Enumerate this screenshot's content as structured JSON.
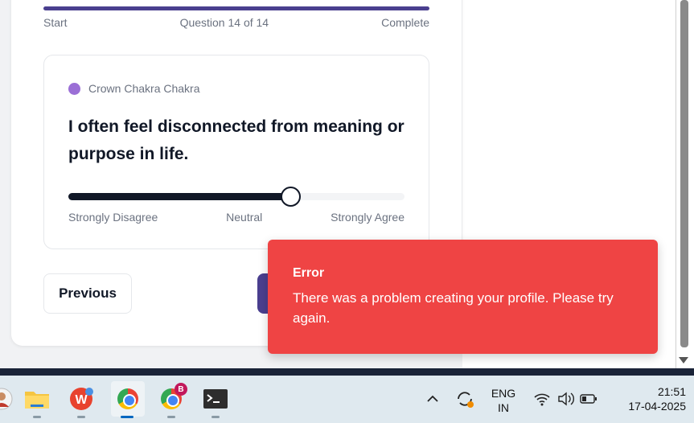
{
  "progress": {
    "start_label": "Start",
    "counter_label": "Question 14 of 14",
    "end_label": "Complete",
    "value_fraction": 1.0,
    "color": "#4a3f8f"
  },
  "question_card": {
    "category": "Crown Chakra Chakra",
    "category_color": "#9b6fd6",
    "question": "I often feel disconnected from meaning or purpose in life.",
    "slider_fraction": 0.66,
    "scale_labels": [
      "Strongly Disagree",
      "Neutral",
      "Strongly Agree"
    ]
  },
  "nav": {
    "previous_label": "Previous",
    "next_color": "#4a3f8f"
  },
  "toast": {
    "title": "Error",
    "message": "There was a problem creating your profile. Please try again.",
    "color": "#ef4444"
  },
  "taskbar": {
    "apps": [
      "person-icon",
      "file-explorer-icon",
      "wps-office-icon",
      "chrome-icon",
      "chrome-profile-icon",
      "terminal-icon"
    ],
    "chrome_profile_badge": "B",
    "tray": {
      "language_line1": "ENG",
      "language_line2": "IN",
      "time": "21:51",
      "date": "17-04-2025"
    }
  }
}
